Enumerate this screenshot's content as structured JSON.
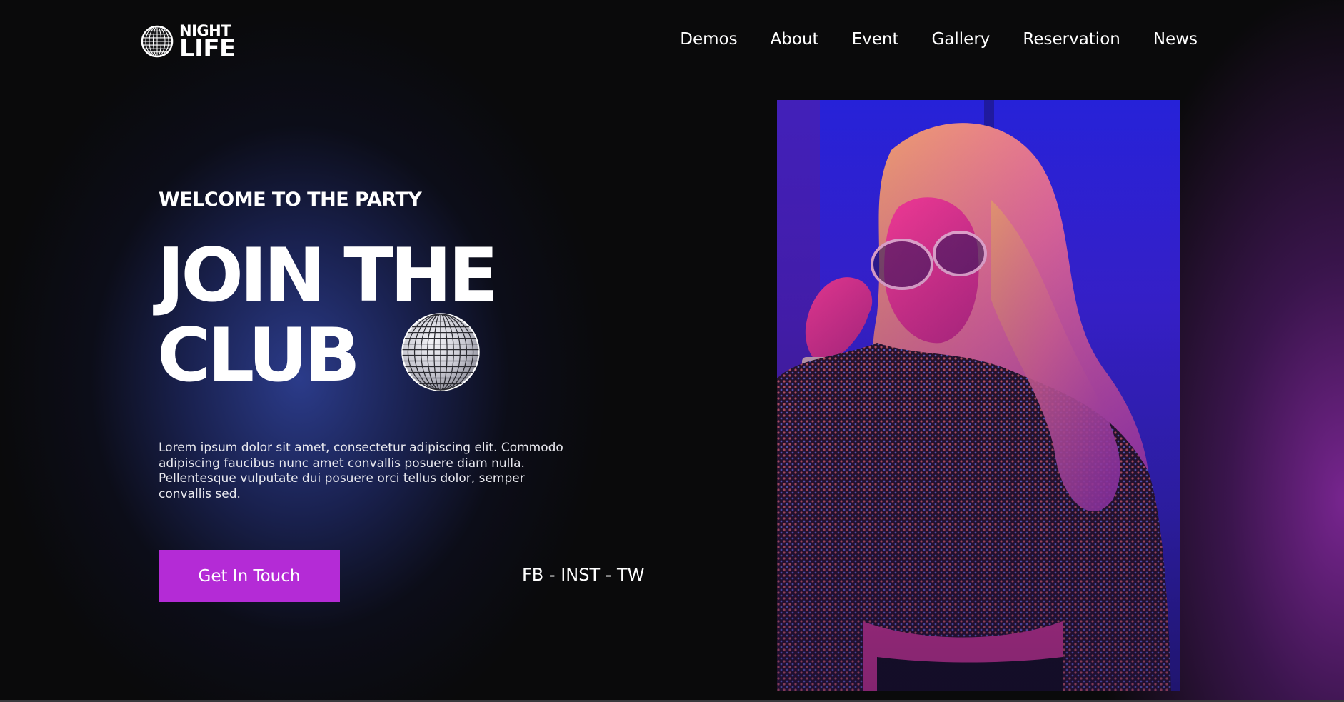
{
  "logo": {
    "line1": "NIGHT",
    "line2": "LIFE",
    "icon": "disco-ball-icon"
  },
  "nav": {
    "items": [
      {
        "label": "Demos"
      },
      {
        "label": "About"
      },
      {
        "label": "Event"
      },
      {
        "label": "Gallery"
      },
      {
        "label": "Reservation"
      },
      {
        "label": "News"
      }
    ]
  },
  "hero": {
    "eyebrow": "WELCOME TO THE PARTY",
    "headline_line1": "JOIN THE",
    "headline_line2": "CLUB",
    "body": "Lorem ipsum dolor sit amet, consectetur adipiscing elit. Commodo adipiscing faucibus nunc amet convallis posuere diam nulla. Pellentesque vulputate dui posuere orci tellus dolor, semper convallis sed.",
    "cta_label": "Get In Touch",
    "social_links": "FB - INST - TW",
    "decoration_icon": "disco-ball-icon"
  },
  "colors": {
    "background": "#0a0a0b",
    "accent": "#b42bd6",
    "glow_blue": "#2d3e91",
    "glow_purple": "#7d2696",
    "text": "#ffffff"
  }
}
